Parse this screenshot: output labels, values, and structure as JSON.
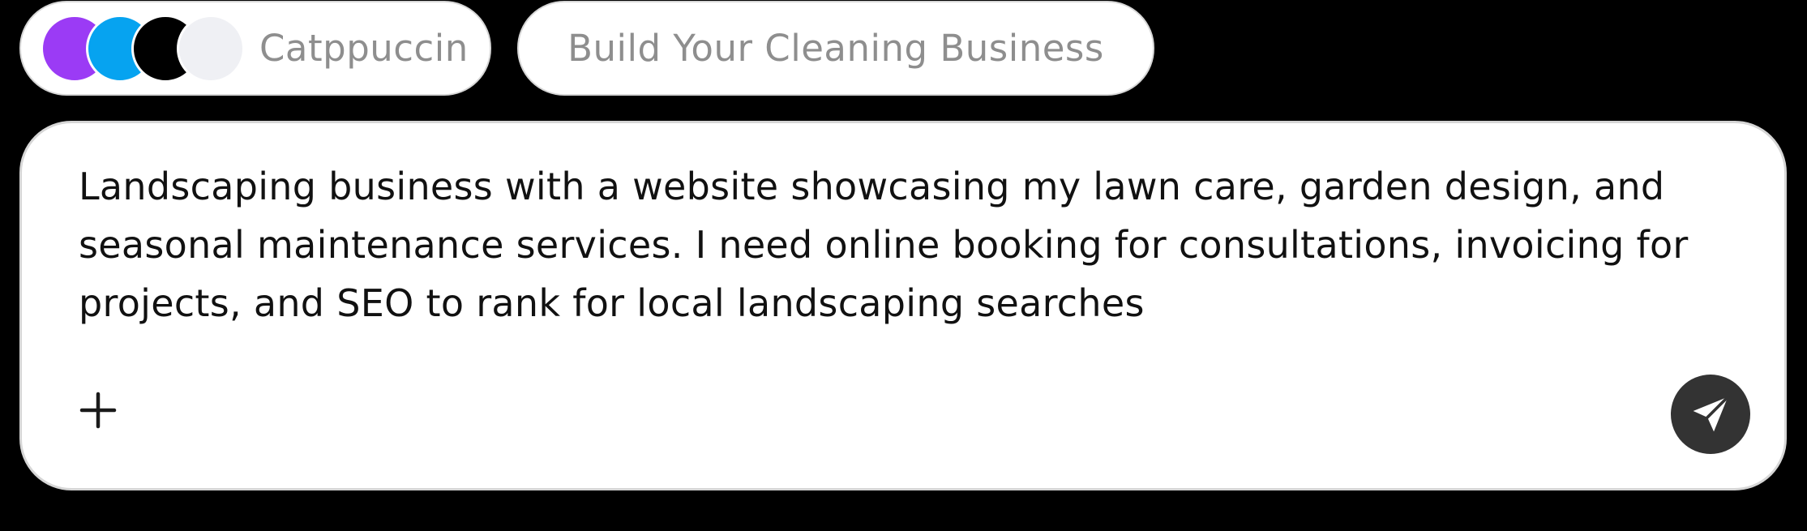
{
  "theme": {
    "label": "Catppuccin",
    "swatches": [
      "#9b3bf5",
      "#06a3f0",
      "#000000",
      "#eff0f4"
    ]
  },
  "suggestion": {
    "label": "Build Your Cleaning Business"
  },
  "composer": {
    "text": "Landscaping business with a website showcasing my lawn care, garden design, and seasonal maintenance services. I need online booking for consultations, invoicing for projects, and SEO to rank for local landscaping searches",
    "add_icon": "plus-icon",
    "send_icon": "send-arrow-icon",
    "send_color": "#333333"
  }
}
